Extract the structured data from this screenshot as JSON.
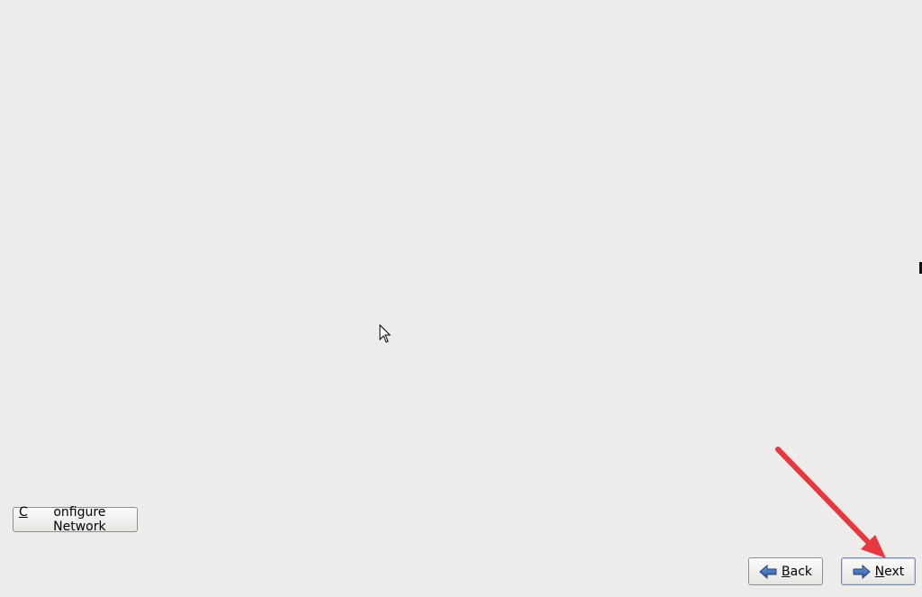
{
  "buttons": {
    "configure_network": {
      "prefix": "C",
      "rest": "onfigure Network"
    },
    "back": {
      "prefix": "B",
      "rest": "ack"
    },
    "next": {
      "prefix": "N",
      "rest": "ext"
    }
  },
  "icons": {
    "back": "back-arrow-icon",
    "next": "forward-arrow-icon",
    "cursor": "mouse-pointer-icon",
    "annotation": "red-annotation-arrow"
  },
  "colors": {
    "background": "#edecea",
    "arrow_blue": "#2f64b0",
    "annotation_red": "#e8383f"
  }
}
